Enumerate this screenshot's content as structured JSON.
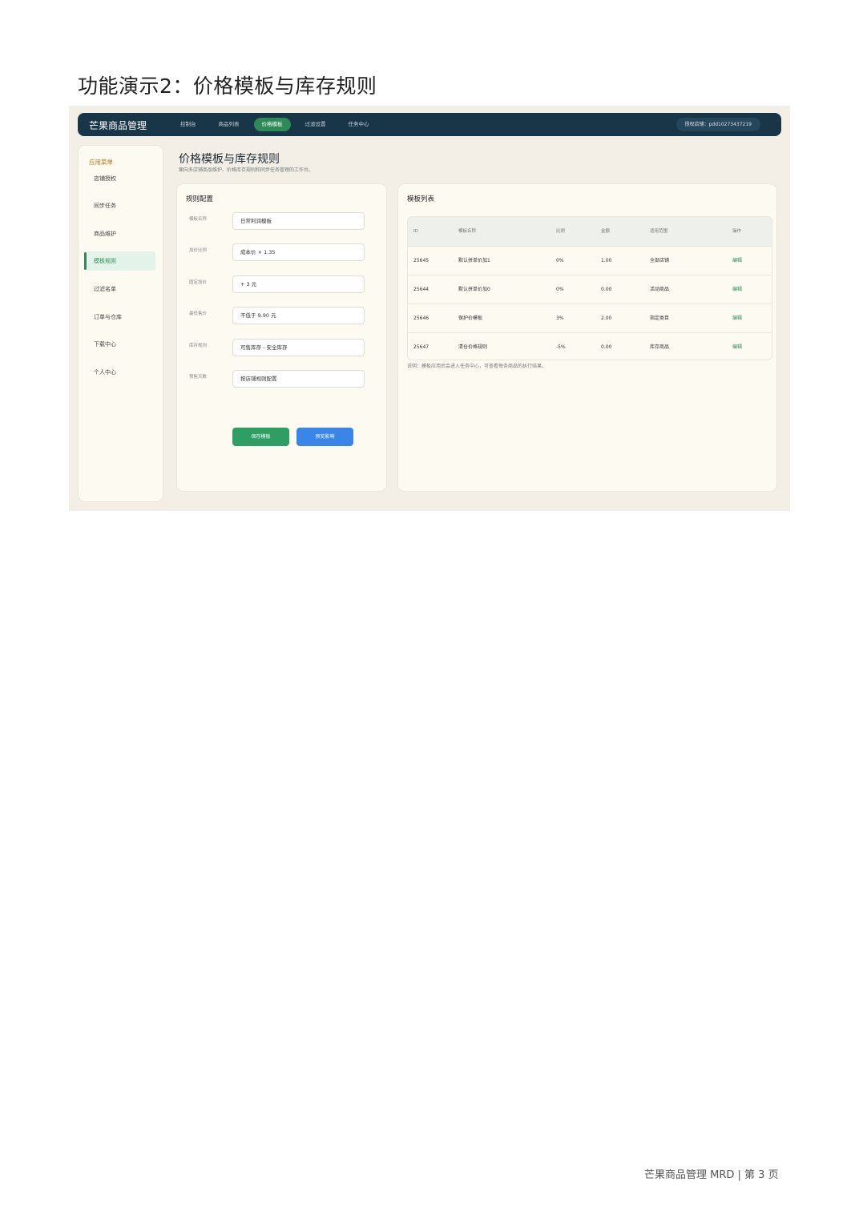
{
  "document": {
    "heading": "功能演示2：价格模板与库存规则",
    "footer": "芒果商品管理 MRD | 第 3 页"
  },
  "app": {
    "brand": "芒果商品管理",
    "nav": [
      "控制台",
      "商品列表",
      "价格模板",
      "过滤设置",
      "任务中心"
    ],
    "nav_active": "价格模板",
    "auth_shop": "授权店铺：pdd10273437219"
  },
  "sidebar": {
    "heading": "应用菜单",
    "items": [
      "店铺授权",
      "同步任务",
      "商品维护",
      "模板规则",
      "过滤名单",
      "订单与仓库",
      "下载中心",
      "个人中心"
    ],
    "active": "模板规则"
  },
  "page": {
    "title": "价格模板与库存规则",
    "subtitle": "面向多店铺商品维护、价格库存规则和同步任务管理的工作台。"
  },
  "rule_config": {
    "title": "规则配置",
    "fields": [
      {
        "label": "模板名称",
        "value": "日常利润模板"
      },
      {
        "label": "加价比例",
        "value": "成本价 × 1.35"
      },
      {
        "label": "固定加价",
        "value": "+ 3 元"
      },
      {
        "label": "最低售价",
        "value": "不低于 9.90 元"
      },
      {
        "label": "库存规则",
        "value": "可售库存 - 安全库存"
      },
      {
        "label": "预售天数",
        "value": "按店铺规则配置"
      }
    ],
    "save_label": "保存模板",
    "preview_label": "预览影响"
  },
  "template_list": {
    "title": "模板列表",
    "columns": [
      "ID",
      "模板名称",
      "比例",
      "金额",
      "适用范围",
      "操作"
    ],
    "rows": [
      [
        "25645",
        "默认拼单价加1",
        "0%",
        "1.00",
        "全部店铺",
        "编辑"
      ],
      [
        "25644",
        "默认拼单价加0",
        "0%",
        "0.00",
        "活动商品",
        "编辑"
      ],
      [
        "25646",
        "保护价模板",
        "3%",
        "2.00",
        "指定类目",
        "编辑"
      ],
      [
        "25647",
        "清仓价格规则",
        "-5%",
        "0.00",
        "库存商品",
        "编辑"
      ]
    ],
    "note": "说明：模板应用后会进入任务中心，可查看每条商品的执行结果。"
  }
}
